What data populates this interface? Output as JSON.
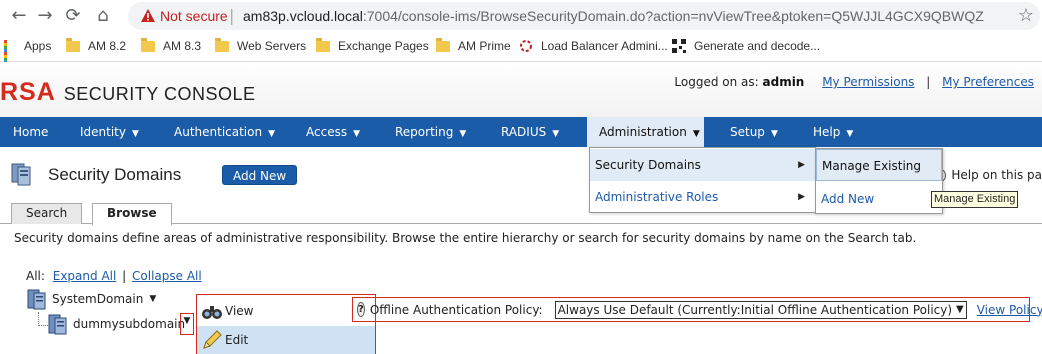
{
  "browser": {
    "security_label": "Not secure",
    "url_host": "am83p.vcloud.local",
    "url_rest": ":7004/console-ims/BrowseSecurityDomain.do?action=nvViewTree&ptoken=Q5WJJL4GCX9QBWQZ",
    "bookmarks": [
      {
        "label": "Apps",
        "icon": "apps-grid-icon"
      },
      {
        "label": "AM 8.2",
        "icon": "folder-icon"
      },
      {
        "label": "AM 8.3",
        "icon": "folder-icon"
      },
      {
        "label": "Web Servers",
        "icon": "folder-icon"
      },
      {
        "label": "Exchange Pages",
        "icon": "folder-icon"
      },
      {
        "label": "AM Prime",
        "icon": "folder-icon"
      },
      {
        "label": "Load Balancer Admini...",
        "icon": "loading-icon"
      },
      {
        "label": "Generate and decode...",
        "icon": "qr-code-icon"
      }
    ]
  },
  "header": {
    "logo_rsa": "RSA",
    "logo_text": "SECURITY CONSOLE",
    "logged_on_label": "Logged on as:",
    "username": "admin",
    "my_permissions": "My Permissions",
    "separator": "|",
    "my_preferences": "My Preferences"
  },
  "menu": [
    {
      "label": "Home",
      "has_caret": false
    },
    {
      "label": "Identity",
      "has_caret": true
    },
    {
      "label": "Authentication",
      "has_caret": true
    },
    {
      "label": "Access",
      "has_caret": true
    },
    {
      "label": "Reporting",
      "has_caret": true
    },
    {
      "label": "RADIUS",
      "has_caret": true
    },
    {
      "label": "Administration",
      "has_caret": true
    },
    {
      "label": "Setup",
      "has_caret": true
    },
    {
      "label": "Help",
      "has_caret": true
    }
  ],
  "admin_dropdown": {
    "items": [
      {
        "label": "Security Domains",
        "arrow": "▶"
      },
      {
        "label": "Administrative Roles",
        "arrow": "▶"
      }
    ]
  },
  "submenu": {
    "items": [
      {
        "label": "Manage Existing"
      },
      {
        "label": "Add New"
      }
    ],
    "tooltip": "Manage Existing"
  },
  "page": {
    "title": "Security Domains",
    "add_new_label": "Add New",
    "help_text": "Help on this pa",
    "tabs": [
      "Search",
      "Browse"
    ],
    "description": "Security domains define areas of administrative responsibility. Browse the entire hierarchy or search for security domains by name on the Search tab.",
    "all_label": "All:",
    "expand_all": "Expand All",
    "tree_separator": "|",
    "collapse_all": "Collapse All"
  },
  "tree": {
    "root": "SystemDomain",
    "child": "dummysubdomain"
  },
  "context_menu": {
    "items": [
      {
        "label": "View",
        "icon": "binoculars-icon"
      },
      {
        "label": "Edit",
        "icon": "pencil-icon"
      }
    ]
  },
  "policy": {
    "label": "Offline Authentication Policy:",
    "selected": "Always Use Default (Currently:Initial Offline Authentication Policy)",
    "view_link": "View Policy"
  },
  "colors": {
    "menu_bar": "#1a5ca8",
    "brand_red": "#d52b1e",
    "link": "#1e5aa8",
    "highlight": "#e1ebf6"
  }
}
